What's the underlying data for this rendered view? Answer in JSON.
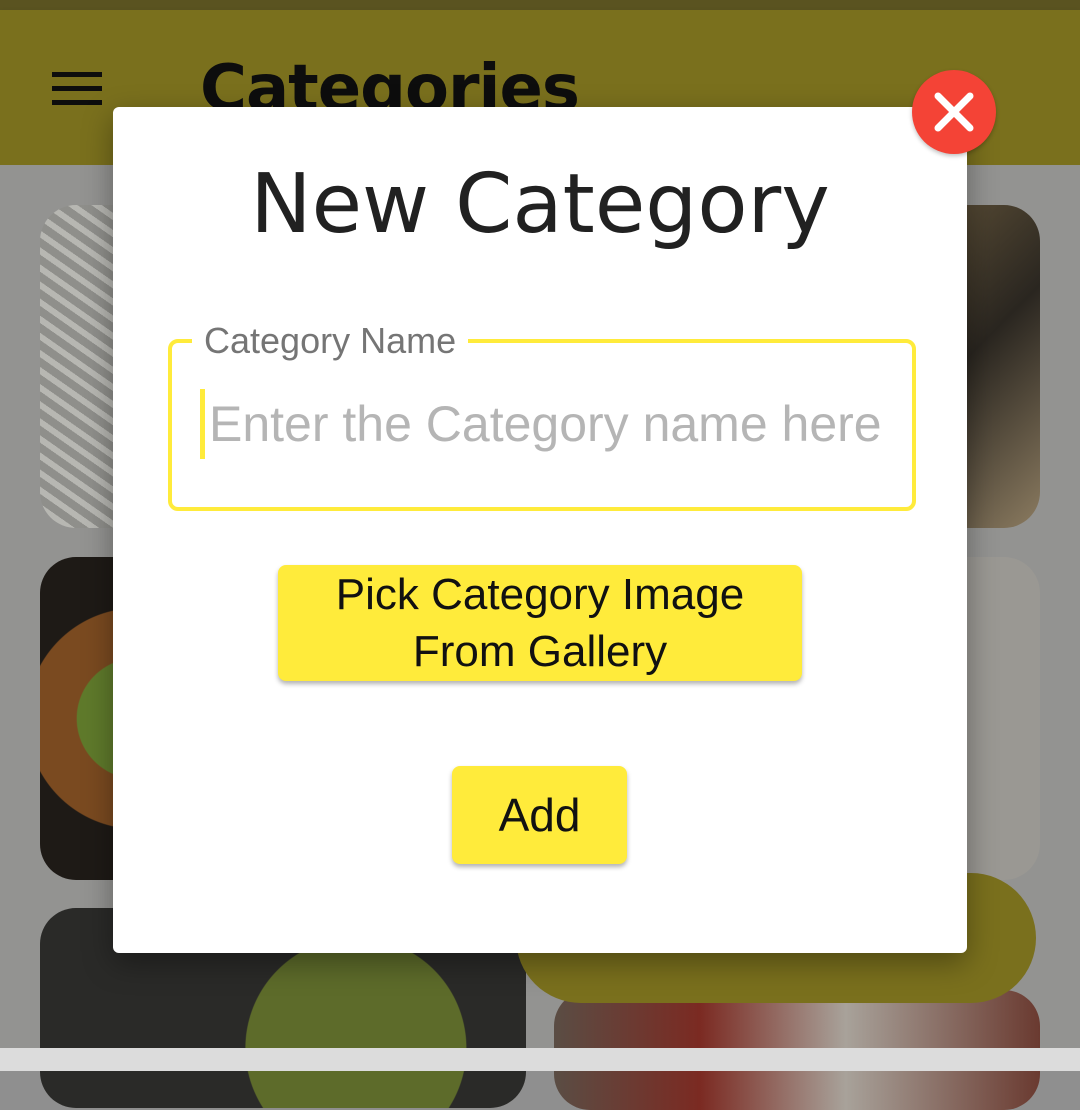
{
  "appbar": {
    "title": "Categories",
    "menu_icon": "hamburger-menu-icon"
  },
  "dialog": {
    "title": "New Category",
    "close_icon": "close-icon",
    "field": {
      "label": "Category Name",
      "placeholder": "Enter the Category name here",
      "value": ""
    },
    "pick_button_label_line1": "Pick Category Image",
    "pick_button_label_line2": "From Gallery",
    "add_button_label": "Add"
  },
  "colors": {
    "accent": "#ffeb3b",
    "close": "#f44336",
    "appbar": "#7a701d"
  }
}
